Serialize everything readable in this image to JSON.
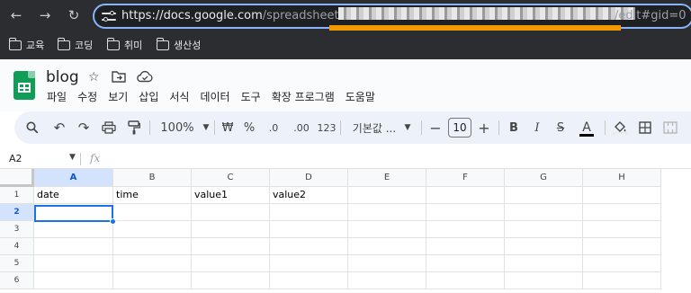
{
  "browser": {
    "back_icon": "←",
    "forward_icon": "→",
    "reload_icon": "↻",
    "url_prefix": "https://docs.google.com",
    "url_path": "/spreadsheets/d/",
    "url_suffix": "/edit#gid=0"
  },
  "bookmarks": [
    "교육",
    "코딩",
    "취미",
    "생산성"
  ],
  "app": {
    "title": "blog",
    "menu": [
      "파일",
      "수정",
      "보기",
      "삽입",
      "서식",
      "데이터",
      "도구",
      "확장 프로그램",
      "도움말"
    ]
  },
  "toolbar": {
    "zoom": "100%",
    "currency": "₩",
    "percent": "%",
    "decrease_decimal": ".0",
    "increase_decimal": ".00",
    "more_formats": "123",
    "font": "기본값 ...",
    "font_size": "10"
  },
  "formula_bar": {
    "name_box": "A2",
    "fx": "fx"
  },
  "grid": {
    "columns": [
      "A",
      "B",
      "C",
      "D",
      "E",
      "F",
      "G",
      "H"
    ],
    "rows": [
      "1",
      "2",
      "3",
      "4",
      "5",
      "6"
    ],
    "cells": {
      "A1": "date",
      "B1": "time",
      "C1": "value1",
      "D1": "value2"
    },
    "selected_cell": "A2"
  },
  "colors": {
    "accent": "#1a73e8",
    "highlight": "#f29900"
  }
}
